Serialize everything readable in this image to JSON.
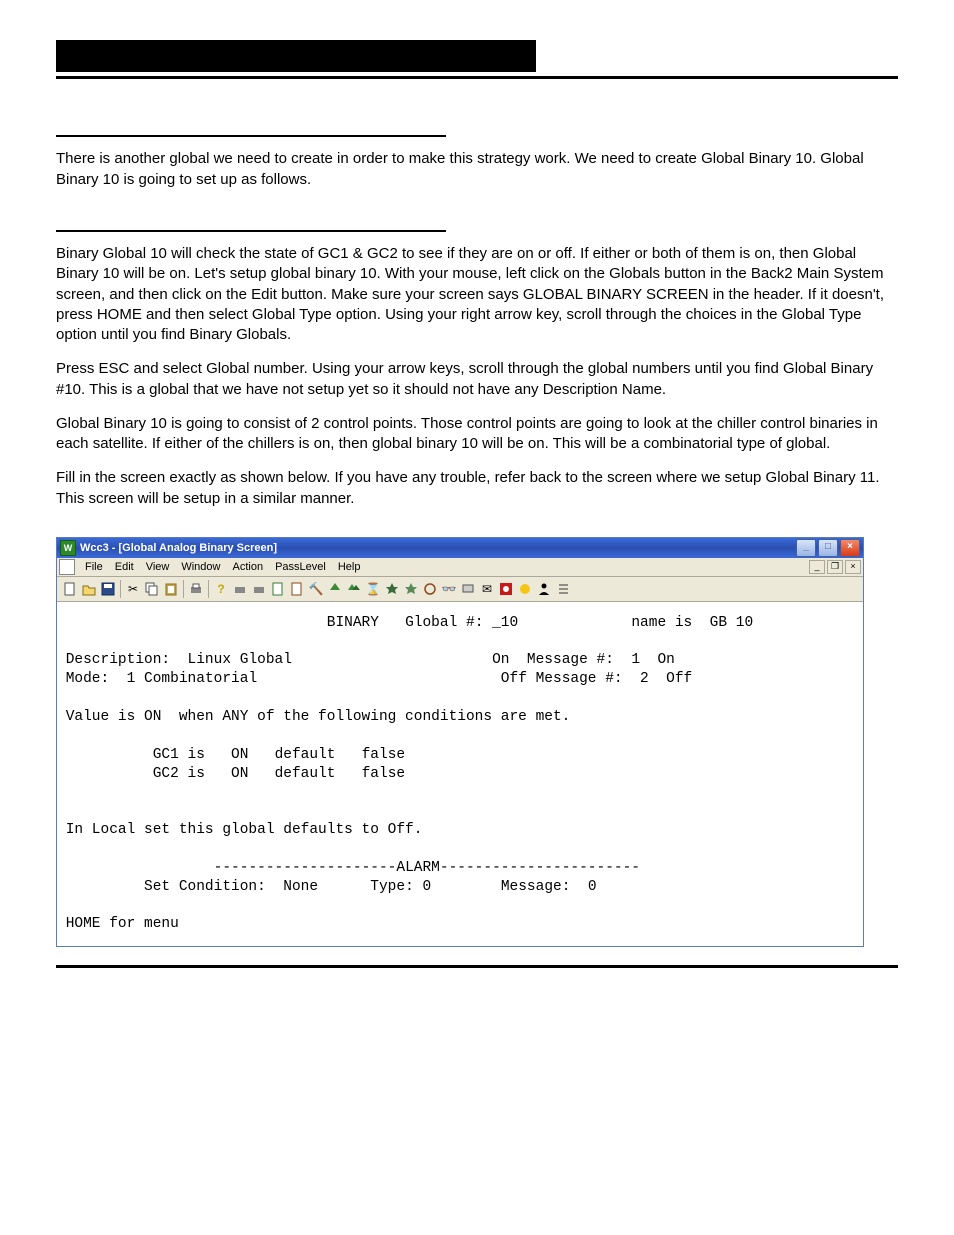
{
  "section1_text": "There is another global we need to create in order to make this strategy work. We need to create Global Binary 10. Global Binary 10 is going to set up as follows.",
  "section2_text": "Binary Global 10 will check the state of GC1 & GC2 to see if they are on or off. If either or both of them is on, then Global Binary 10 will be on. Let's setup global binary 10. With your mouse, left click on the Globals button in the Back2 Main System screen, and then click on the Edit button. Make sure your screen says GLOBAL BINARY SCREEN in the header. If it doesn't, press HOME and then select Global Type option. Using your right arrow key, scroll through the choices in the Global Type option until you find Binary Globals.",
  "section3_text": "Press ESC and select Global number. Using your arrow keys, scroll through the global numbers until you find Global Binary #10. This is a global that we have not setup yet so it should not have any Description Name.",
  "section4_text": "Global Binary 10 is going to consist of 2 control points. Those control points are going to look at the chiller control binaries in each satellite. If either of the chillers is on, then global binary 10 will be on. This will be a combinatorial type of global.",
  "section5_text": "Fill in the screen exactly as shown below. If you have any trouble, refer back to the screen where we setup Global Binary 11. This screen will be setup in a similar manner.",
  "window": {
    "title": "Wcc3 - [Global Analog Binary Screen]",
    "menu": [
      "File",
      "Edit",
      "View",
      "Window",
      "Action",
      "PassLevel",
      "Help"
    ]
  },
  "screen": {
    "header": {
      "kind": "BINARY",
      "global_label": "Global #:",
      "global_num": "_10",
      "name_label": "name is",
      "name": "GB 10"
    },
    "desc_label": "Description:",
    "description": "Linux Global",
    "mode_label": "Mode:",
    "mode": "1 Combinatorial",
    "on_msg_label": "On  Message #:",
    "on_msg_num": "1",
    "on_msg_text": "On",
    "off_msg_label": "Off Message #:",
    "off_msg_num": "2",
    "off_msg_text": "Off",
    "value_line": "Value is ON  when ANY of the following conditions are met.",
    "conditions": [
      {
        "point": "GC1",
        "is": "is",
        "state": "ON",
        "def_lbl": "default",
        "def_val": "false"
      },
      {
        "point": "GC2",
        "is": "is",
        "state": "ON",
        "def_lbl": "default",
        "def_val": "false"
      }
    ],
    "local_line": "In Local set this global defaults to Off.",
    "alarm_divider": "---------------------ALARM-----------------------",
    "alarm_set_label": "Set Condition:",
    "alarm_set": "None",
    "alarm_type_label": "Type:",
    "alarm_type": "0",
    "alarm_msg_label": "Message:",
    "alarm_msg": "0",
    "footer": "HOME for menu"
  }
}
